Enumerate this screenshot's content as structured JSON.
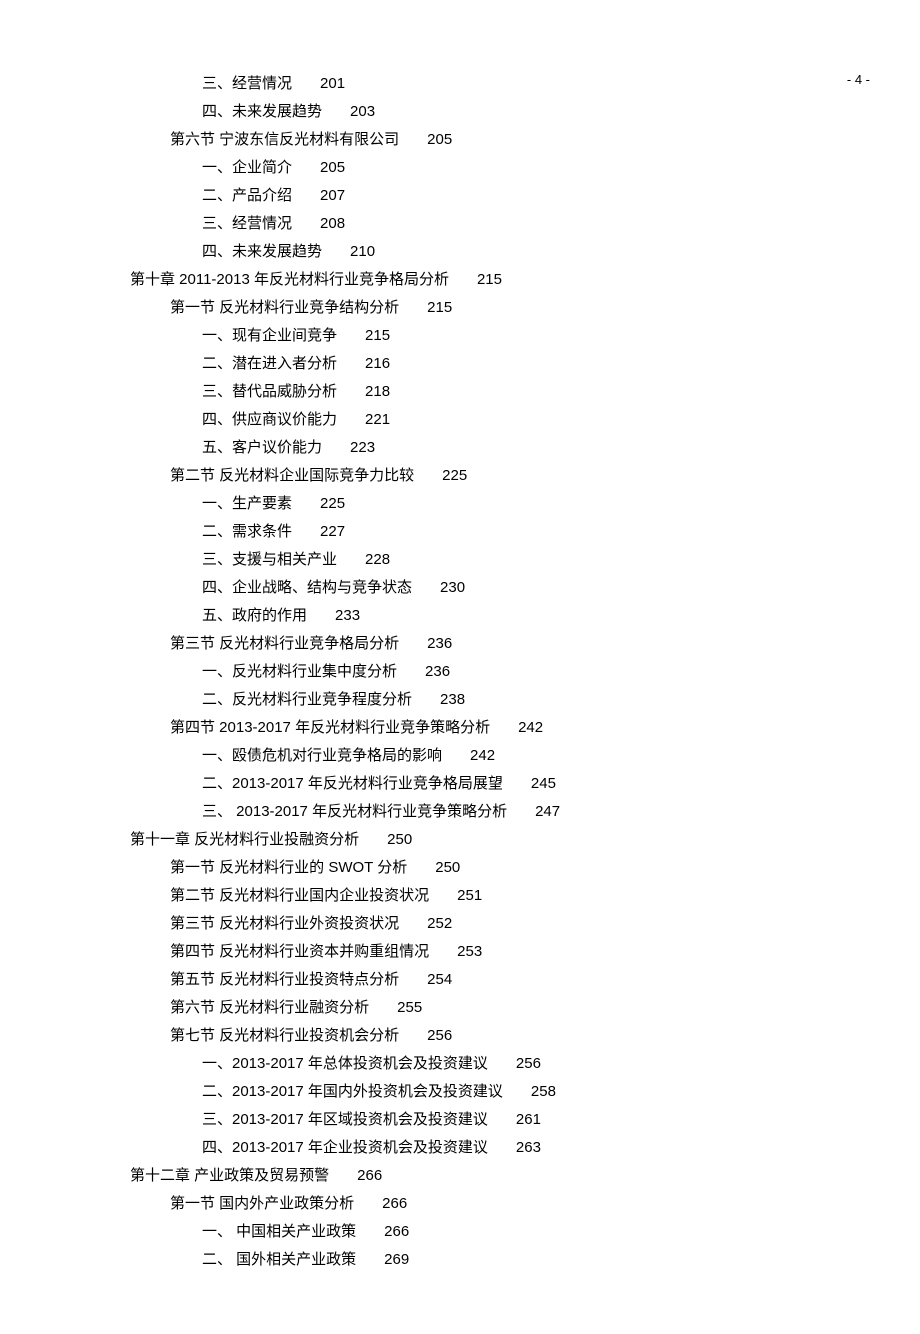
{
  "page_number": "- 4 -",
  "toc": [
    {
      "indent": 2,
      "text": "三、经营情况",
      "page": "201"
    },
    {
      "indent": 2,
      "text": "四、未来发展趋势",
      "page": "203"
    },
    {
      "indent": 1,
      "text": "第六节   宁波东信反光材料有限公司",
      "page": "205"
    },
    {
      "indent": 2,
      "text": "一、企业简介",
      "page": "205"
    },
    {
      "indent": 2,
      "text": "二、产品介绍",
      "page": "207"
    },
    {
      "indent": 2,
      "text": "三、经营情况",
      "page": "208"
    },
    {
      "indent": 2,
      "text": "四、未来发展趋势",
      "page": "210"
    },
    {
      "indent": 0,
      "text": "第十章   2011-2013 年反光材料行业竞争格局分析",
      "page": "215"
    },
    {
      "indent": 1,
      "text": "第一节   反光材料行业竞争结构分析",
      "page": "215"
    },
    {
      "indent": 2,
      "text": "一、现有企业间竞争",
      "page": "215"
    },
    {
      "indent": 2,
      "text": "二、潜在进入者分析",
      "page": "216"
    },
    {
      "indent": 2,
      "text": "三、替代品威胁分析",
      "page": "218"
    },
    {
      "indent": 2,
      "text": "四、供应商议价能力",
      "page": "221"
    },
    {
      "indent": 2,
      "text": "五、客户议价能力",
      "page": "223"
    },
    {
      "indent": 1,
      "text": "第二节   反光材料企业国际竞争力比较",
      "page": "225"
    },
    {
      "indent": 2,
      "text": "一、生产要素",
      "page": "225"
    },
    {
      "indent": 2,
      "text": "二、需求条件",
      "page": "227"
    },
    {
      "indent": 2,
      "text": "三、支援与相关产业",
      "page": "228"
    },
    {
      "indent": 2,
      "text": "四、企业战略、结构与竞争状态",
      "page": "230"
    },
    {
      "indent": 2,
      "text": "五、政府的作用",
      "page": "233"
    },
    {
      "indent": 1,
      "text": "第三节   反光材料行业竞争格局分析",
      "page": "236"
    },
    {
      "indent": 2,
      "text": "一、反光材料行业集中度分析",
      "page": "236"
    },
    {
      "indent": 2,
      "text": "二、反光材料行业竞争程度分析",
      "page": "238"
    },
    {
      "indent": 1,
      "text": "第四节   2013-2017 年反光材料行业竞争策略分析",
      "page": "242"
    },
    {
      "indent": 2,
      "text": "一、殴债危机对行业竞争格局的影响",
      "page": "242"
    },
    {
      "indent": 2,
      "text": "二、2013-2017 年反光材料行业竞争格局展望",
      "page": "245"
    },
    {
      "indent": 2,
      "text": "三、 2013-2017 年反光材料行业竞争策略分析",
      "page": "247"
    },
    {
      "indent": 0,
      "text": "第十一章   反光材料行业投融资分析",
      "page": "250"
    },
    {
      "indent": 1,
      "text": "第一节   反光材料行业的 SWOT 分析",
      "page": "250"
    },
    {
      "indent": 1,
      "text": "第二节   反光材料行业国内企业投资状况",
      "page": "251"
    },
    {
      "indent": 1,
      "text": "第三节   反光材料行业外资投资状况",
      "page": "252"
    },
    {
      "indent": 1,
      "text": "第四节   反光材料行业资本并购重组情况",
      "page": "253"
    },
    {
      "indent": 1,
      "text": "第五节   反光材料行业投资特点分析",
      "page": "254"
    },
    {
      "indent": 1,
      "text": "第六节   反光材料行业融资分析",
      "page": "255"
    },
    {
      "indent": 1,
      "text": "第七节   反光材料行业投资机会分析",
      "page": "256"
    },
    {
      "indent": 2,
      "text": "一、2013-2017 年总体投资机会及投资建议",
      "page": "256"
    },
    {
      "indent": 2,
      "text": "二、2013-2017 年国内外投资机会及投资建议",
      "page": "258"
    },
    {
      "indent": 2,
      "text": "三、2013-2017 年区域投资机会及投资建议",
      "page": "261"
    },
    {
      "indent": 2,
      "text": "四、2013-2017 年企业投资机会及投资建议",
      "page": "263"
    },
    {
      "indent": 0,
      "text": "第十二章   产业政策及贸易预警",
      "page": "266"
    },
    {
      "indent": 1,
      "text": "第一节   国内外产业政策分析",
      "page": "266"
    },
    {
      "indent": 2,
      "text": "一、 中国相关产业政策",
      "page": "266"
    },
    {
      "indent": 2,
      "text": "二、 国外相关产业政策",
      "page": "269"
    }
  ]
}
